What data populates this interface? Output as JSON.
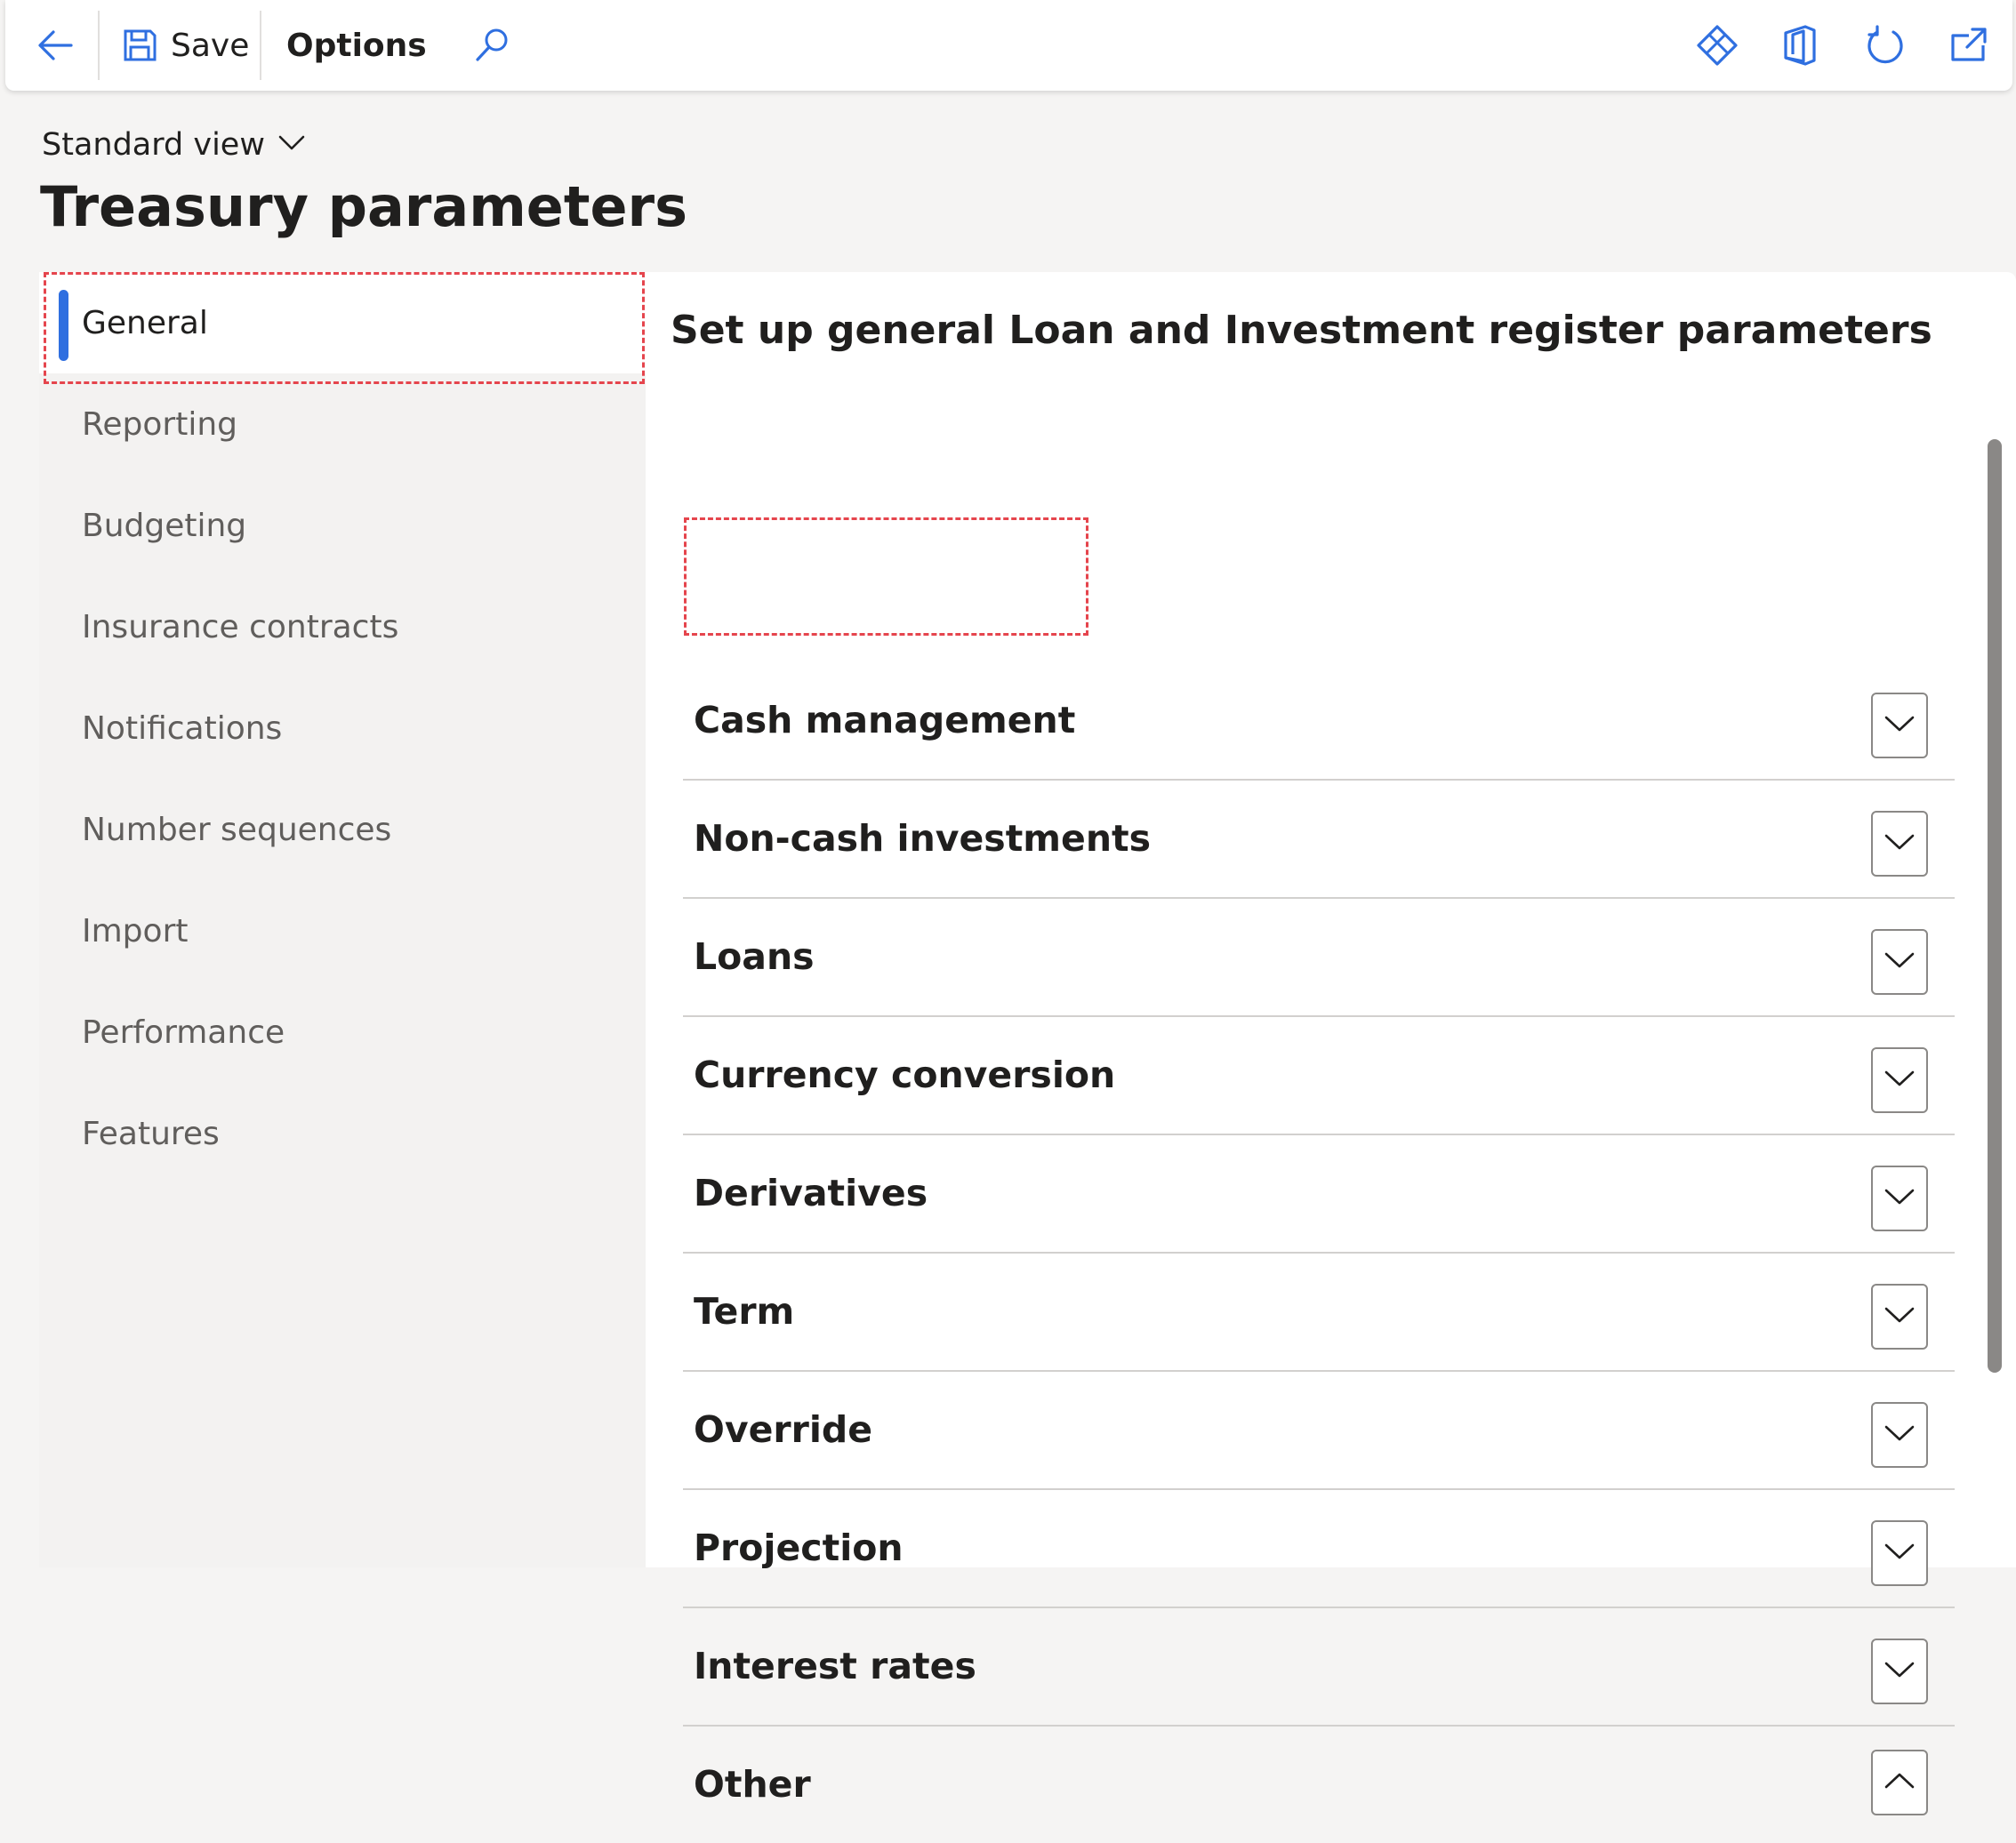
{
  "toolbar": {
    "save_label": "Save",
    "options_label": "Options",
    "icons": [
      "back-arrow-icon",
      "save-icon",
      "search-icon",
      "diamond-icon",
      "office-icon",
      "refresh-icon",
      "open-new-window-icon"
    ]
  },
  "header": {
    "view_label": "Standard view",
    "page_title": "Treasury parameters"
  },
  "nav": {
    "items": [
      {
        "label": "General",
        "selected": true
      },
      {
        "label": "Reporting",
        "selected": false
      },
      {
        "label": "Budgeting",
        "selected": false
      },
      {
        "label": "Insurance contracts",
        "selected": false
      },
      {
        "label": "Notifications",
        "selected": false
      },
      {
        "label": "Number sequences",
        "selected": false
      },
      {
        "label": "Import",
        "selected": false
      },
      {
        "label": "Performance",
        "selected": false
      },
      {
        "label": "Features",
        "selected": false
      }
    ]
  },
  "main": {
    "section_title": "Set up general Loan and Investment register parameters",
    "fasttabs": [
      {
        "label": "Cash management",
        "expanded": false
      },
      {
        "label": "Non-cash investments",
        "expanded": false
      },
      {
        "label": "Loans",
        "expanded": false
      },
      {
        "label": "Currency conversion",
        "expanded": false
      },
      {
        "label": "Derivatives",
        "expanded": false
      },
      {
        "label": "Term",
        "expanded": false
      },
      {
        "label": "Override",
        "expanded": false
      },
      {
        "label": "Projection",
        "expanded": false
      },
      {
        "label": "Interest rates",
        "expanded": false
      },
      {
        "label": "Other",
        "expanded": true
      }
    ]
  },
  "colors": {
    "accent": "#2f6fe0",
    "highlight": "#e5454d",
    "text": "#201f1e",
    "muted_text": "#605e5c"
  }
}
